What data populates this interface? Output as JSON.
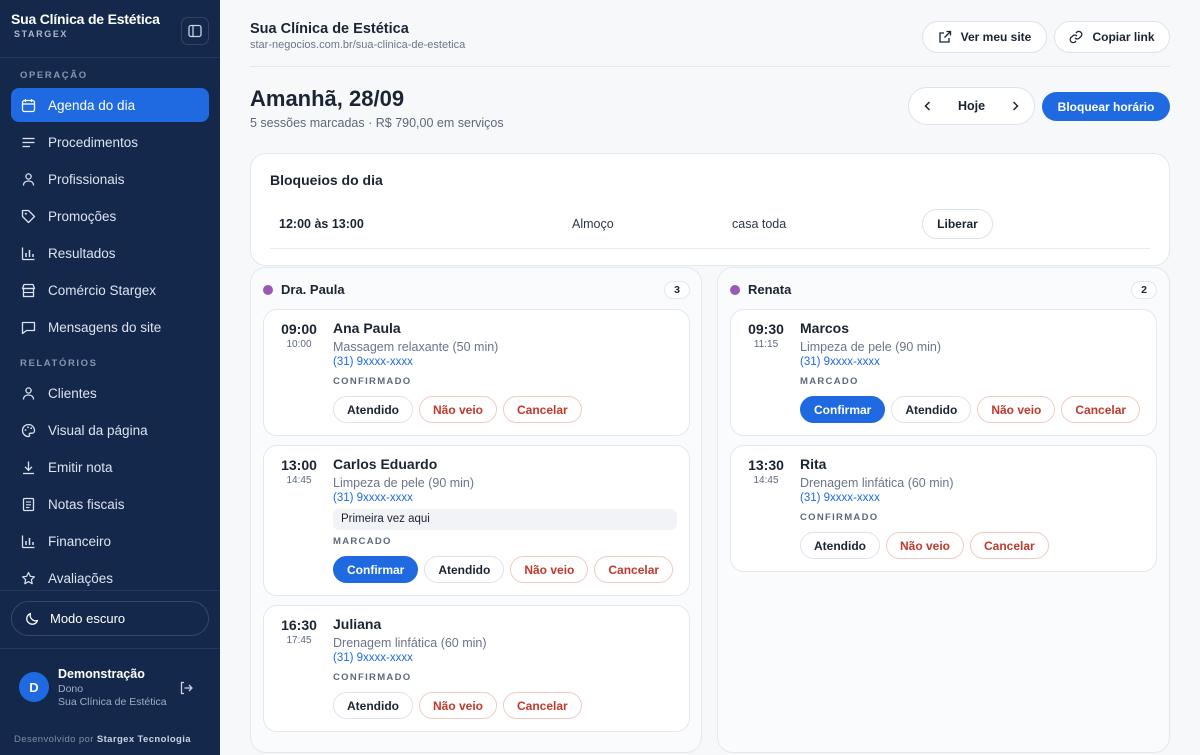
{
  "sidebar": {
    "brand_name": "Sua Clínica de Estética",
    "brand_sub": "STARGEX",
    "sections": [
      {
        "label": "OPERAÇÃO"
      },
      {
        "label": "RELATÓRIOS"
      }
    ],
    "items": [
      {
        "label": "Agenda do dia",
        "icon": "calendar-icon",
        "active": true
      },
      {
        "label": "Procedimentos",
        "icon": "list-icon"
      },
      {
        "label": "Profissionais",
        "icon": "user-icon"
      },
      {
        "label": "Promoções",
        "icon": "tag-icon"
      },
      {
        "label": "Resultados",
        "icon": "bar-chart-icon"
      },
      {
        "label": "Comércio Stargex",
        "icon": "store-icon"
      },
      {
        "label": "Mensagens do site",
        "icon": "message-icon"
      },
      {
        "label": "Clientes",
        "icon": "user-icon"
      },
      {
        "label": "Visual da página",
        "icon": "palette-icon"
      },
      {
        "label": "Emitir nota",
        "icon": "download-icon"
      },
      {
        "label": "Notas fiscais",
        "icon": "receipt-icon"
      },
      {
        "label": "Financeiro",
        "icon": "bar-chart-icon"
      },
      {
        "label": "Avaliações",
        "icon": "star-icon"
      }
    ],
    "dark_mode_label": "Modo escuro",
    "user": {
      "initial": "D",
      "name": "Demonstração",
      "role": "Dono",
      "clinic": "Sua Clínica de Estética"
    },
    "footer_prefix": "Desenvolvido por",
    "footer_company": "Stargex Tecnologia"
  },
  "header": {
    "title": "Sua Clínica de Estética",
    "url": "star-negocios.com.br/sua-clinica-de-estetica",
    "view_site_label": "Ver meu site",
    "copy_link_label": "Copiar link"
  },
  "day": {
    "title": "Amanhã, 28/09",
    "summary": "5 sessões marcadas · R$ 790,00 em serviços",
    "today_label": "Hoje",
    "block_button_label": "Bloquear horário"
  },
  "blocks": {
    "title": "Bloqueios do dia",
    "rows": [
      {
        "time": "12:00 às 13:00",
        "reason": "Almoço",
        "scope": "casa toda",
        "action_label": "Liberar"
      }
    ]
  },
  "columns": [
    {
      "name": "Dra. Paula",
      "count": "3",
      "color": "#9b59b6",
      "appointments": [
        {
          "start": "09:00",
          "end": "10:00",
          "client": "Ana Paula",
          "service": "Massagem relaxante (50 min)",
          "phone": "(31) 9xxxx-xxxx",
          "note": "",
          "status": "CONFIRMADO",
          "buttons": [
            "Atendido",
            "Não veio",
            "Cancelar"
          ]
        },
        {
          "start": "13:00",
          "end": "14:45",
          "client": "Carlos Eduardo",
          "service": "Limpeza de pele (90 min)",
          "phone": "(31) 9xxxx-xxxx",
          "note": "Primeira vez aqui",
          "status": "MARCADO",
          "buttons": [
            "Confirmar",
            "Atendido",
            "Não veio",
            "Cancelar"
          ]
        },
        {
          "start": "16:30",
          "end": "17:45",
          "client": "Juliana",
          "service": "Drenagem linfática (60 min)",
          "phone": "(31) 9xxxx-xxxx",
          "note": "",
          "status": "CONFIRMADO",
          "buttons": [
            "Atendido",
            "Não veio",
            "Cancelar"
          ]
        }
      ]
    },
    {
      "name": "Renata",
      "count": "2",
      "color": "#9b59b6",
      "appointments": [
        {
          "start": "09:30",
          "end": "11:15",
          "client": "Marcos",
          "service": "Limpeza de pele (90 min)",
          "phone": "(31) 9xxxx-xxxx",
          "note": "",
          "status": "MARCADO",
          "buttons": [
            "Confirmar",
            "Atendido",
            "Não veio",
            "Cancelar"
          ]
        },
        {
          "start": "13:30",
          "end": "14:45",
          "client": "Rita",
          "service": "Drenagem linfática (60 min)",
          "phone": "(31) 9xxxx-xxxx",
          "note": "",
          "status": "CONFIRMADO",
          "buttons": [
            "Atendido",
            "Não veio",
            "Cancelar"
          ]
        }
      ]
    }
  ],
  "colors": {
    "sidebar_bg": "#13284a",
    "accent": "#1f6ae0",
    "danger": "#c0392b",
    "professional_dot": "#9b59b6"
  }
}
